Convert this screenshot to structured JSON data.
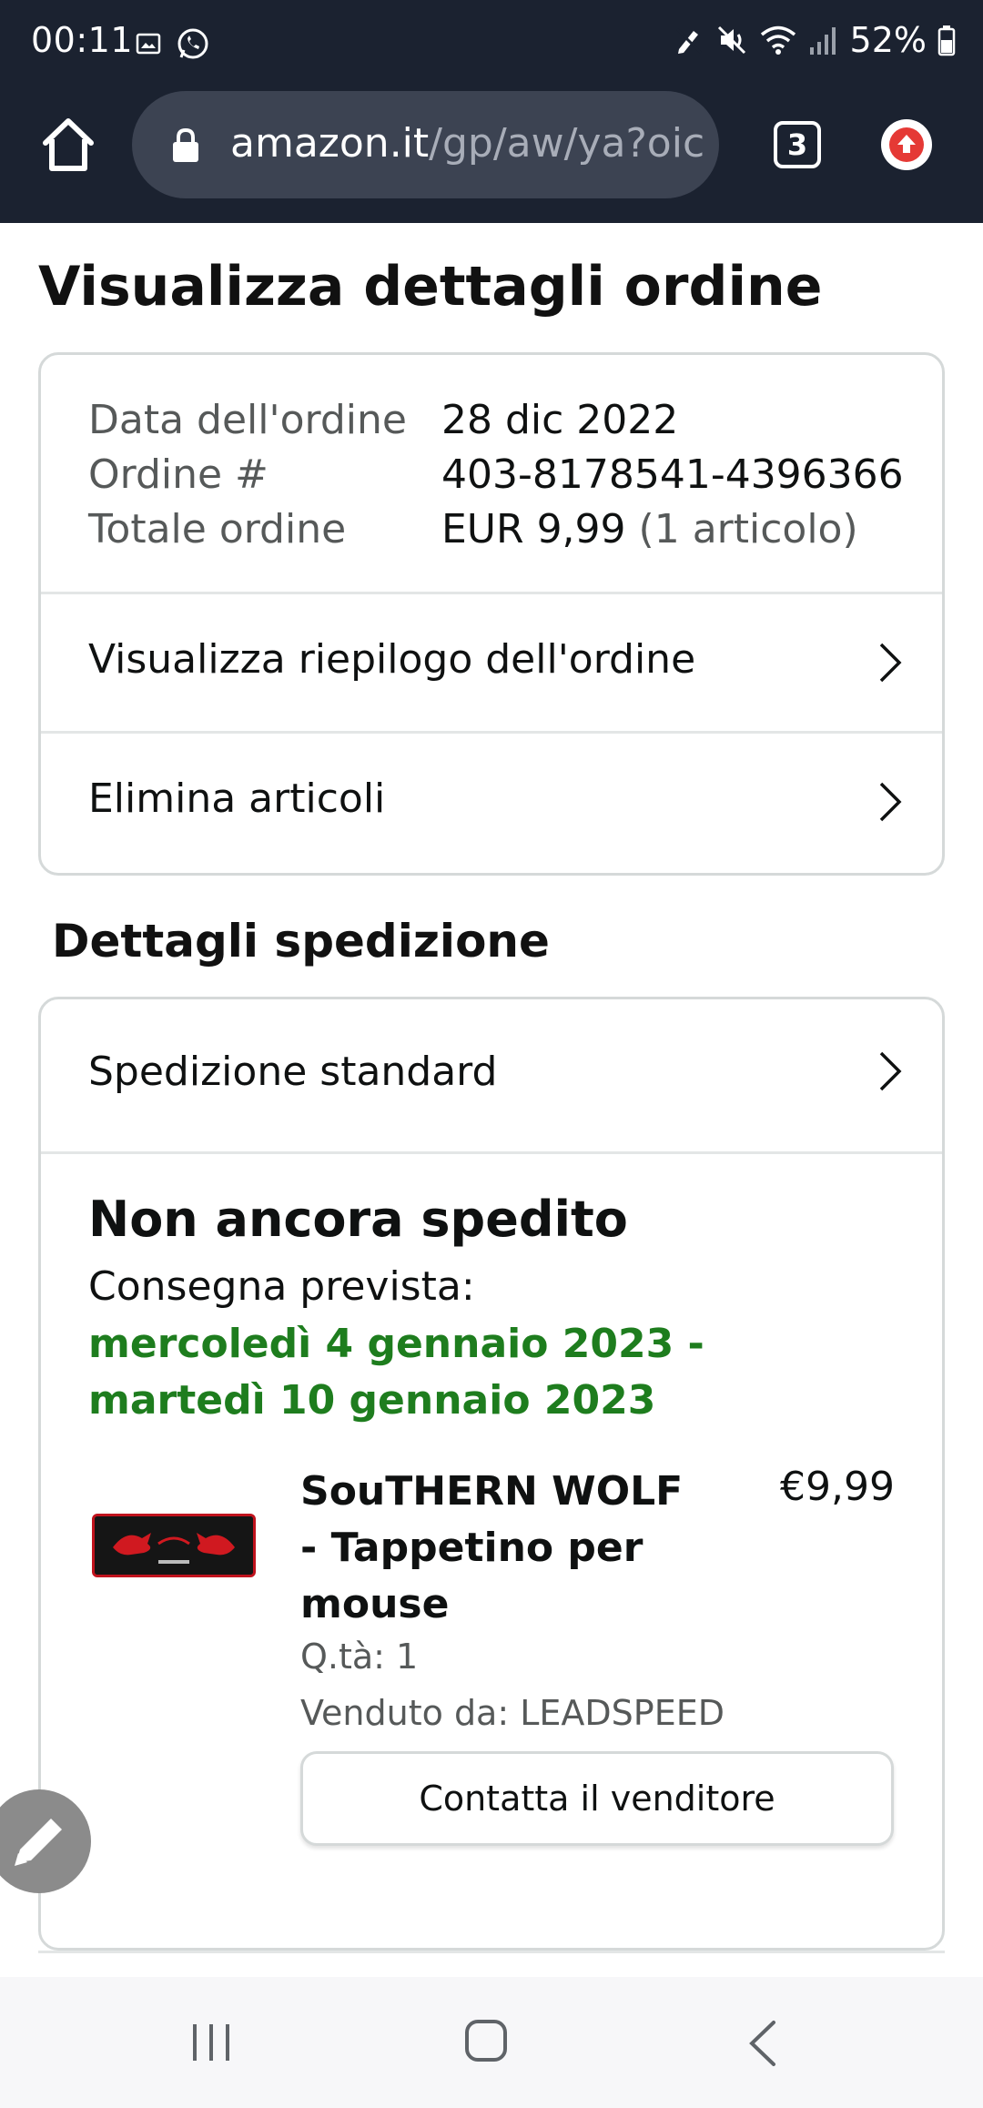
{
  "status_bar": {
    "time": "00:11",
    "battery": "52%"
  },
  "browser": {
    "url_host": "amazon.it",
    "url_path": "/gp/aw/ya?oic",
    "tab_count": "3"
  },
  "page": {
    "title": "Visualizza dettagli ordine"
  },
  "order_info": {
    "date_label": "Data dell'ordine",
    "date_value": "28 dic 2022",
    "number_label": "Ordine #",
    "number_value": "403-8178541-4396366",
    "total_label": "Totale ordine",
    "total_value": "EUR 9,99",
    "total_items": "(1 articolo)"
  },
  "links": {
    "summary": "Visualizza riepilogo dell'ordine",
    "delete_items": "Elimina articoli"
  },
  "shipping": {
    "section_title": "Dettagli spedizione",
    "method": "Spedizione standard",
    "status": "Non ancora spedito",
    "delivery_label": "Consegna prevista:",
    "delivery_range": "mercoledì 4 gennaio 2023 - martedì 10 gennaio 2023"
  },
  "product": {
    "title": "SouTHERN WOLF - Tappetino per mouse",
    "price": "€9,99",
    "quantity": "Q.tà: 1",
    "seller": "Venduto da: LEADSPEED",
    "contact_button": "Contatta il venditore"
  },
  "colors": {
    "status_bar_bg": "#1b2230",
    "delivery_green": "#1e7d1e",
    "border": "#d5d9d9"
  }
}
